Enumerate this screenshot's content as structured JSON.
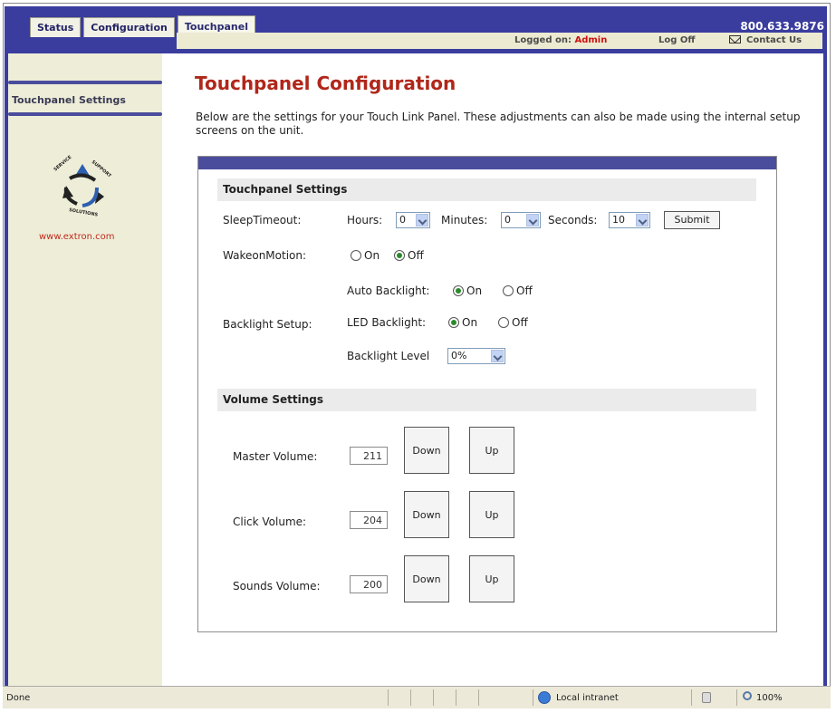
{
  "tabs": [
    {
      "label": "Status",
      "active": false
    },
    {
      "label": "Configuration",
      "active": false
    },
    {
      "label": "Touchpanel",
      "active": true
    }
  ],
  "header": {
    "phone": "800.633.9876",
    "logged_on_label": "Logged on:",
    "logged_on_user": "Admin",
    "log_off": "Log Off",
    "contact_us": "Contact Us",
    "color": "#3a3d9e"
  },
  "sidebar": {
    "items": [
      {
        "label": "Touchpanel Settings"
      }
    ],
    "logo_text": "SERVICE SUPPORT SOLUTIONS",
    "logo_url": "www.extron.com"
  },
  "main": {
    "title": "Touchpanel Configuration",
    "intro": "Below are the settings for your Touch Link Panel. These adjustments can also be made using the internal setup screens on the unit."
  },
  "touchpanel_settings": {
    "heading": "Touchpanel Settings",
    "sleep_timeout": {
      "label": "SleepTimeout:",
      "hours_label": "Hours:",
      "hours_value": "0",
      "minutes_label": "Minutes:",
      "minutes_value": "0",
      "seconds_label": "Seconds:",
      "seconds_value": "10",
      "submit_label": "Submit"
    },
    "wakeon_motion": {
      "label": "WakeonMotion:",
      "on_label": "On",
      "off_label": "Off",
      "selected": "Off"
    },
    "backlight": {
      "label": "Backlight Setup:",
      "auto_label": "Auto Backlight:",
      "auto_on_label": "On",
      "auto_off_label": "Off",
      "auto_selected": "On",
      "led_label": "LED Backlight:",
      "led_on_label": "On",
      "led_off_label": "Off",
      "led_selected": "On",
      "level_label": "Backlight Level",
      "level_value": "0%"
    }
  },
  "volume_settings": {
    "heading": "Volume Settings",
    "rows": [
      {
        "label": "Master Volume:",
        "value": "211",
        "down": "Down",
        "up": "Up"
      },
      {
        "label": "Click Volume:",
        "value": "204",
        "down": "Down",
        "up": "Up"
      },
      {
        "label": "Sounds Volume:",
        "value": "200",
        "down": "Down",
        "up": "Up"
      }
    ]
  },
  "statusbar": {
    "status": "Done",
    "zone": "Local intranet",
    "zoom": "100%"
  }
}
